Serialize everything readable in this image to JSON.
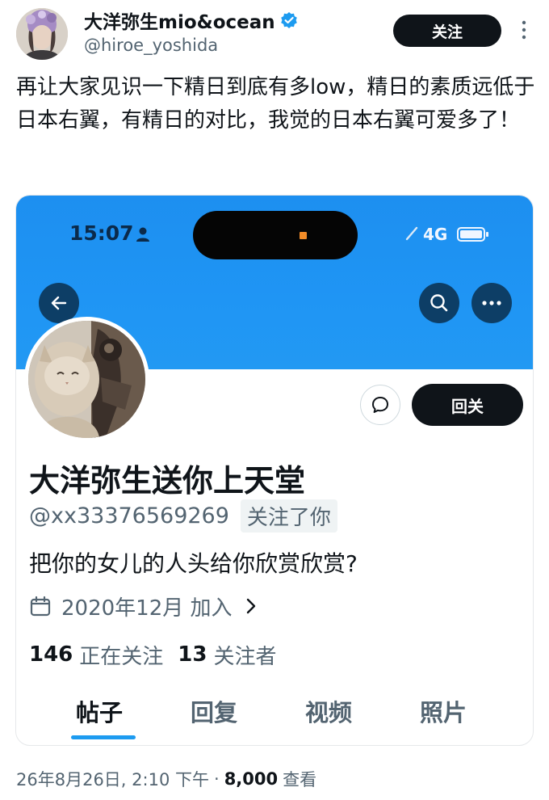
{
  "tweet": {
    "author_name": "大洋弥生mio&ocean",
    "author_handle": "@hiroe_yoshida",
    "follow_label": "关注",
    "text": "再让大家见识一下精日到底有多low，精日的素质远低于日本右翼，有精日的对比，我觉的日本右翼可爱多了！"
  },
  "screenshot": {
    "status_bar": {
      "time": "15:07",
      "network": "4G",
      "icons": [
        "person-icon",
        "signal-icon",
        "battery-icon"
      ]
    },
    "nav_icons": [
      "back-arrow-icon",
      "search-icon",
      "more-horizontal-icon"
    ],
    "message_icon": "message-icon",
    "follow_back_label": "回关",
    "profile": {
      "name": "大洋弥生送你上天堂",
      "handle": "@xx33376569269",
      "follows_you": "关注了你",
      "bio": "把你的女儿的人头给你欣赏欣赏?",
      "joined": "2020年12月 加入",
      "following_count": "146",
      "following_label": "正在关注",
      "followers_count": "13",
      "followers_label": "关注者"
    },
    "tabs": [
      {
        "label": "帖子",
        "active": true
      },
      {
        "label": "回复",
        "active": false
      },
      {
        "label": "视频",
        "active": false
      },
      {
        "label": "照片",
        "active": false
      }
    ],
    "colors": {
      "banner": "#1d8ff0",
      "accent": "#1d9bf0",
      "button_dark": "#0f1419",
      "nav_button": "#0d3e66"
    }
  },
  "footer": {
    "datetime": "26年8月26日, 2:10 下午",
    "separator": "·",
    "views_count": "8,000",
    "views_label": "查看"
  }
}
